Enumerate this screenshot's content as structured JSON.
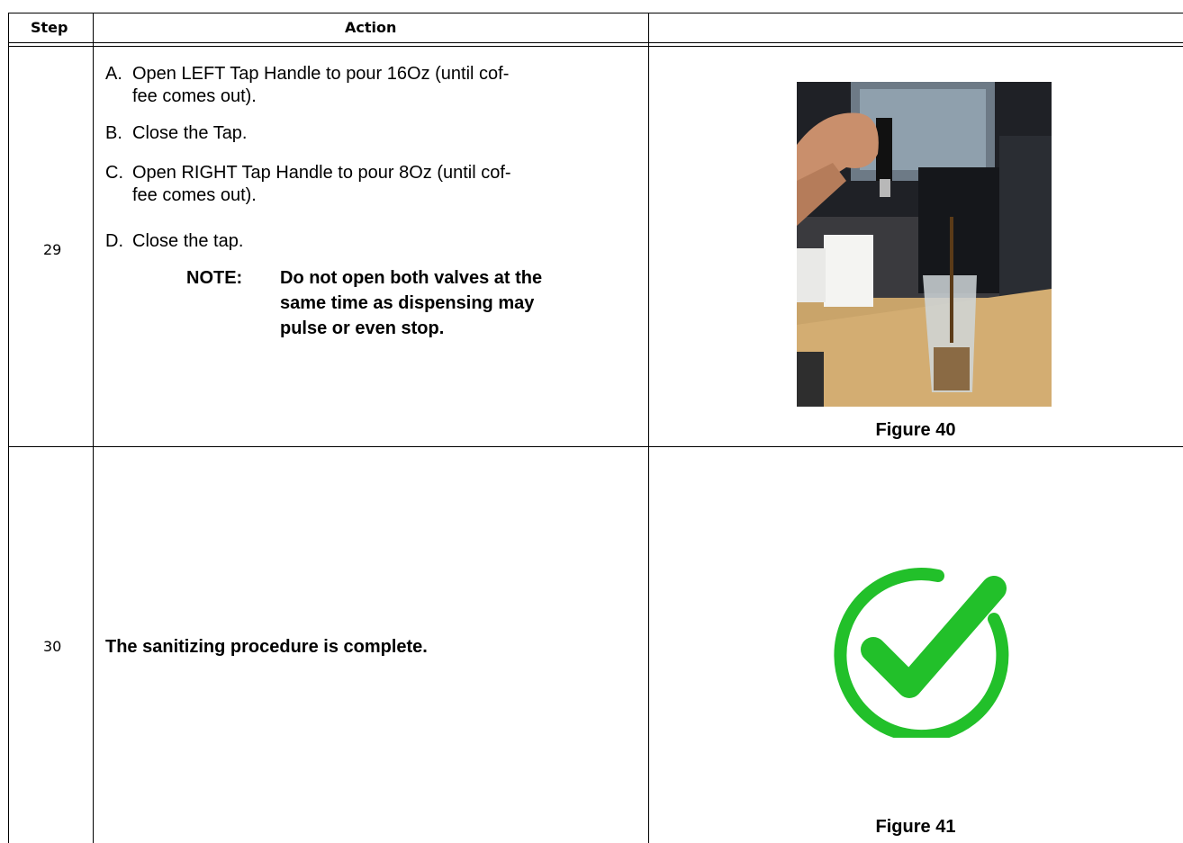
{
  "table": {
    "headers": {
      "step": "Step",
      "action": "Action",
      "figure": ""
    },
    "rows": [
      {
        "step": "29",
        "items": [
          {
            "label": "A.",
            "line1": "Open LEFT Tap Handle to pour 16Oz (until cof-",
            "line2": "fee comes out)."
          },
          {
            "label": "B.",
            "line1": "Close the Tap."
          },
          {
            "label": "C.",
            "line1": "Open RIGHT Tap Handle to pour 8Oz (until cof-",
            "line2": "fee comes out)."
          },
          {
            "label": "D.",
            "line1": "Close the tap."
          }
        ],
        "note": {
          "label": "NOTE:",
          "line1": "Do not open both valves at the",
          "line2": "same time as dispensing may",
          "line3": "pulse or even stop."
        },
        "figure_caption": "Figure 40",
        "figure_icon": "coffee-dispenser-photo"
      },
      {
        "step": "30",
        "text": "The sanitizing procedure is complete.",
        "figure_caption": "Figure 41",
        "figure_icon": "checkmark-circle-icon",
        "icon_color": "#22c02a"
      }
    ]
  }
}
